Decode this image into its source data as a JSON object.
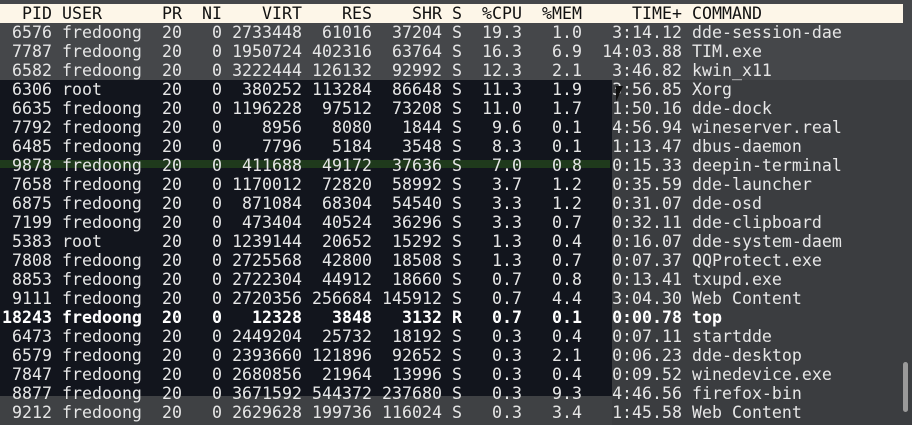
{
  "header": {
    "pid": "PID",
    "user": "USER",
    "pr": "PR",
    "ni": "NI",
    "virt": "VIRT",
    "res": "RES",
    "shr": "SHR",
    "s": "S",
    "cpu": "%CPU",
    "mem": "%MEM",
    "time": "TIME+",
    "command": "COMMAND"
  },
  "processes": [
    [
      "6576",
      "fredoong",
      "20",
      "0",
      "2733448",
      "61016",
      "37204",
      "S",
      "19.3",
      "1.0",
      "3:14.12",
      "dde-session-dae"
    ],
    [
      "7787",
      "fredoong",
      "20",
      "0",
      "1950724",
      "402316",
      "63764",
      "S",
      "16.3",
      "6.9",
      "14:03.88",
      "TIM.exe"
    ],
    [
      "6582",
      "fredoong",
      "20",
      "0",
      "3222444",
      "126132",
      "92992",
      "S",
      "12.3",
      "2.1",
      "3:46.82",
      "kwin_x11"
    ],
    [
      "6306",
      "root",
      "20",
      "0",
      "380252",
      "113284",
      "86648",
      "S",
      "11.3",
      "1.9",
      "3:56.85",
      "Xorg"
    ],
    [
      "6635",
      "fredoong",
      "20",
      "0",
      "1196228",
      "97512",
      "73208",
      "S",
      "11.0",
      "1.7",
      "1:50.16",
      "dde-dock"
    ],
    [
      "7792",
      "fredoong",
      "20",
      "0",
      "8956",
      "8080",
      "1844",
      "S",
      "9.6",
      "0.1",
      "4:56.94",
      "wineserver.real"
    ],
    [
      "6485",
      "fredoong",
      "20",
      "0",
      "7796",
      "5184",
      "3548",
      "S",
      "8.3",
      "0.1",
      "1:13.47",
      "dbus-daemon"
    ],
    [
      "9878",
      "fredoong",
      "20",
      "0",
      "411688",
      "49172",
      "37636",
      "S",
      "7.0",
      "0.8",
      "0:15.33",
      "deepin-terminal"
    ],
    [
      "7658",
      "fredoong",
      "20",
      "0",
      "1170012",
      "72820",
      "58992",
      "S",
      "3.7",
      "1.2",
      "0:35.59",
      "dde-launcher"
    ],
    [
      "6875",
      "fredoong",
      "20",
      "0",
      "871084",
      "68304",
      "54540",
      "S",
      "3.3",
      "1.2",
      "0:31.07",
      "dde-osd"
    ],
    [
      "7199",
      "fredoong",
      "20",
      "0",
      "473404",
      "40524",
      "36296",
      "S",
      "3.3",
      "0.7",
      "0:32.11",
      "dde-clipboard"
    ],
    [
      "5383",
      "root",
      "20",
      "0",
      "1239144",
      "20652",
      "15292",
      "S",
      "1.3",
      "0.4",
      "0:16.07",
      "dde-system-daem"
    ],
    [
      "7808",
      "fredoong",
      "20",
      "0",
      "2725568",
      "42800",
      "18508",
      "S",
      "1.3",
      "0.7",
      "0:07.37",
      "QQProtect.exe"
    ],
    [
      "8853",
      "fredoong",
      "20",
      "0",
      "2722304",
      "44912",
      "18660",
      "S",
      "0.7",
      "0.8",
      "0:13.41",
      "txupd.exe"
    ],
    [
      "9111",
      "fredoong",
      "20",
      "0",
      "2720356",
      "256684",
      "145912",
      "S",
      "0.7",
      "4.4",
      "3:04.30",
      "Web Content"
    ],
    [
      "18243",
      "fredoong",
      "20",
      "0",
      "12328",
      "3848",
      "3132",
      "R",
      "0.7",
      "0.1",
      "0:00.78",
      "top"
    ],
    [
      "6473",
      "fredoong",
      "20",
      "0",
      "2449204",
      "25732",
      "18192",
      "S",
      "0.3",
      "0.4",
      "0:07.11",
      "startdde"
    ],
    [
      "6579",
      "fredoong",
      "20",
      "0",
      "2393660",
      "121896",
      "92652",
      "S",
      "0.3",
      "2.1",
      "0:06.23",
      "dde-desktop"
    ],
    [
      "7847",
      "fredoong",
      "20",
      "0",
      "2680856",
      "21964",
      "13996",
      "S",
      "0.3",
      "0.4",
      "0:09.52",
      "winedevice.exe"
    ],
    [
      "8877",
      "fredoong",
      "20",
      "0",
      "3671592",
      "544372",
      "237680",
      "S",
      "0.3",
      "9.3",
      "4:46.56",
      "firefox-bin"
    ],
    [
      "9212",
      "fredoong",
      "20",
      "0",
      "2629628",
      "199736",
      "116024",
      "S",
      "0.3",
      "3.4",
      "1:45.58",
      "Web Content"
    ]
  ],
  "highlighted_pid": "18243"
}
